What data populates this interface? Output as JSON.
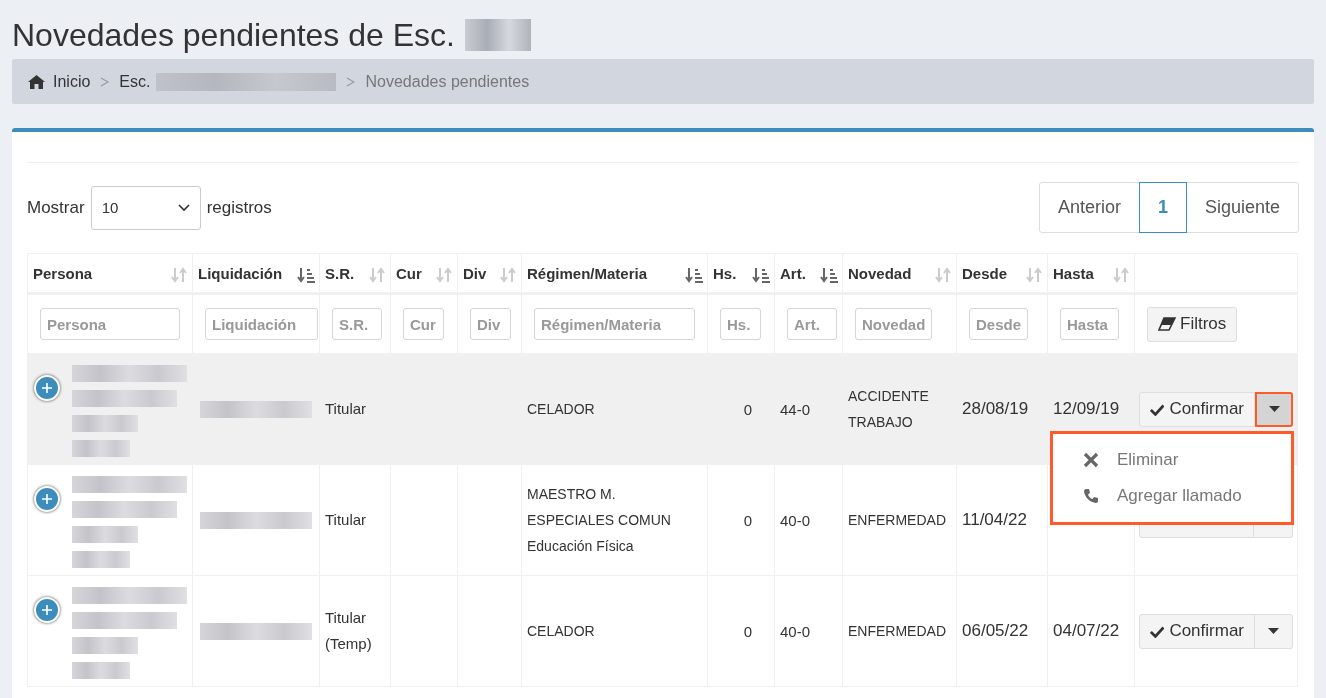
{
  "title": "Novedades pendientes de Esc.",
  "breadcrumb": [
    {
      "label": "Inicio",
      "kind": "home"
    },
    {
      "label": "Esc.",
      "kind": "school"
    },
    {
      "label": "Novedades pendientes",
      "kind": "current"
    }
  ],
  "length": {
    "before": "Mostrar",
    "value": "10",
    "after": "registros"
  },
  "pagination": [
    {
      "label": "Anterior",
      "selected": false
    },
    {
      "label": "1",
      "selected": true
    },
    {
      "label": "Siguiente",
      "selected": false
    }
  ],
  "columns": [
    {
      "label": "Persona",
      "sorted": false
    },
    {
      "label": "Liquidación",
      "sorted": true
    },
    {
      "label": "S.R.",
      "sorted": false
    },
    {
      "label": "Cur",
      "sorted": false
    },
    {
      "label": "Div",
      "sorted": false
    },
    {
      "label": "Régimen/Materia",
      "sorted": true
    },
    {
      "label": "Hs.",
      "sorted": true
    },
    {
      "label": "Art.",
      "sorted": true
    },
    {
      "label": "Novedad",
      "sorted": false
    },
    {
      "label": "Desde",
      "sorted": false
    },
    {
      "label": "Hasta",
      "sorted": false
    }
  ],
  "filters": [
    {
      "placeholder": "Persona"
    },
    {
      "placeholder": "Liquidación"
    },
    {
      "placeholder": "S.R."
    },
    {
      "placeholder": "Cur"
    },
    {
      "placeholder": "Div"
    },
    {
      "placeholder": "Régimen/Materia"
    },
    {
      "placeholder": "Hs."
    },
    {
      "placeholder": "Art."
    },
    {
      "placeholder": "Novedad"
    },
    {
      "placeholder": "Desde"
    },
    {
      "placeholder": "Hasta"
    }
  ],
  "filter_button": "Filtros",
  "rows": [
    {
      "highlighted": true,
      "sr": [
        "Titular"
      ],
      "materia": [
        "CELADOR"
      ],
      "hs": "0",
      "art": "44-0",
      "novedad": [
        "ACCIDENTE",
        "TRABAJO"
      ],
      "desde": "28/08/19",
      "hasta": "12/09/19",
      "action": "Confirmar",
      "menu": {
        "open": true,
        "outlined": true,
        "items": [
          {
            "kind": "delete",
            "label": "Eliminar"
          },
          {
            "kind": "call",
            "label": "Agregar llamado"
          }
        ]
      }
    },
    {
      "highlighted": false,
      "sr": [
        "Titular"
      ],
      "materia": [
        "MAESTRO M.",
        "ESPECIALES COMUN",
        "Educación Física"
      ],
      "hs": "0",
      "art": "40-0",
      "novedad": [
        "ENFERMEDAD"
      ],
      "desde": "11/04/22"
    },
    {
      "highlighted": false,
      "sr": [
        "Titular",
        "(Temp)"
      ],
      "materia": [
        "CELADOR"
      ],
      "hs": "0",
      "art": "40-0",
      "novedad": [
        "ENFERMEDAD"
      ],
      "desde": "06/05/22",
      "hasta": "04/07/22",
      "action": "Confirmar"
    }
  ]
}
